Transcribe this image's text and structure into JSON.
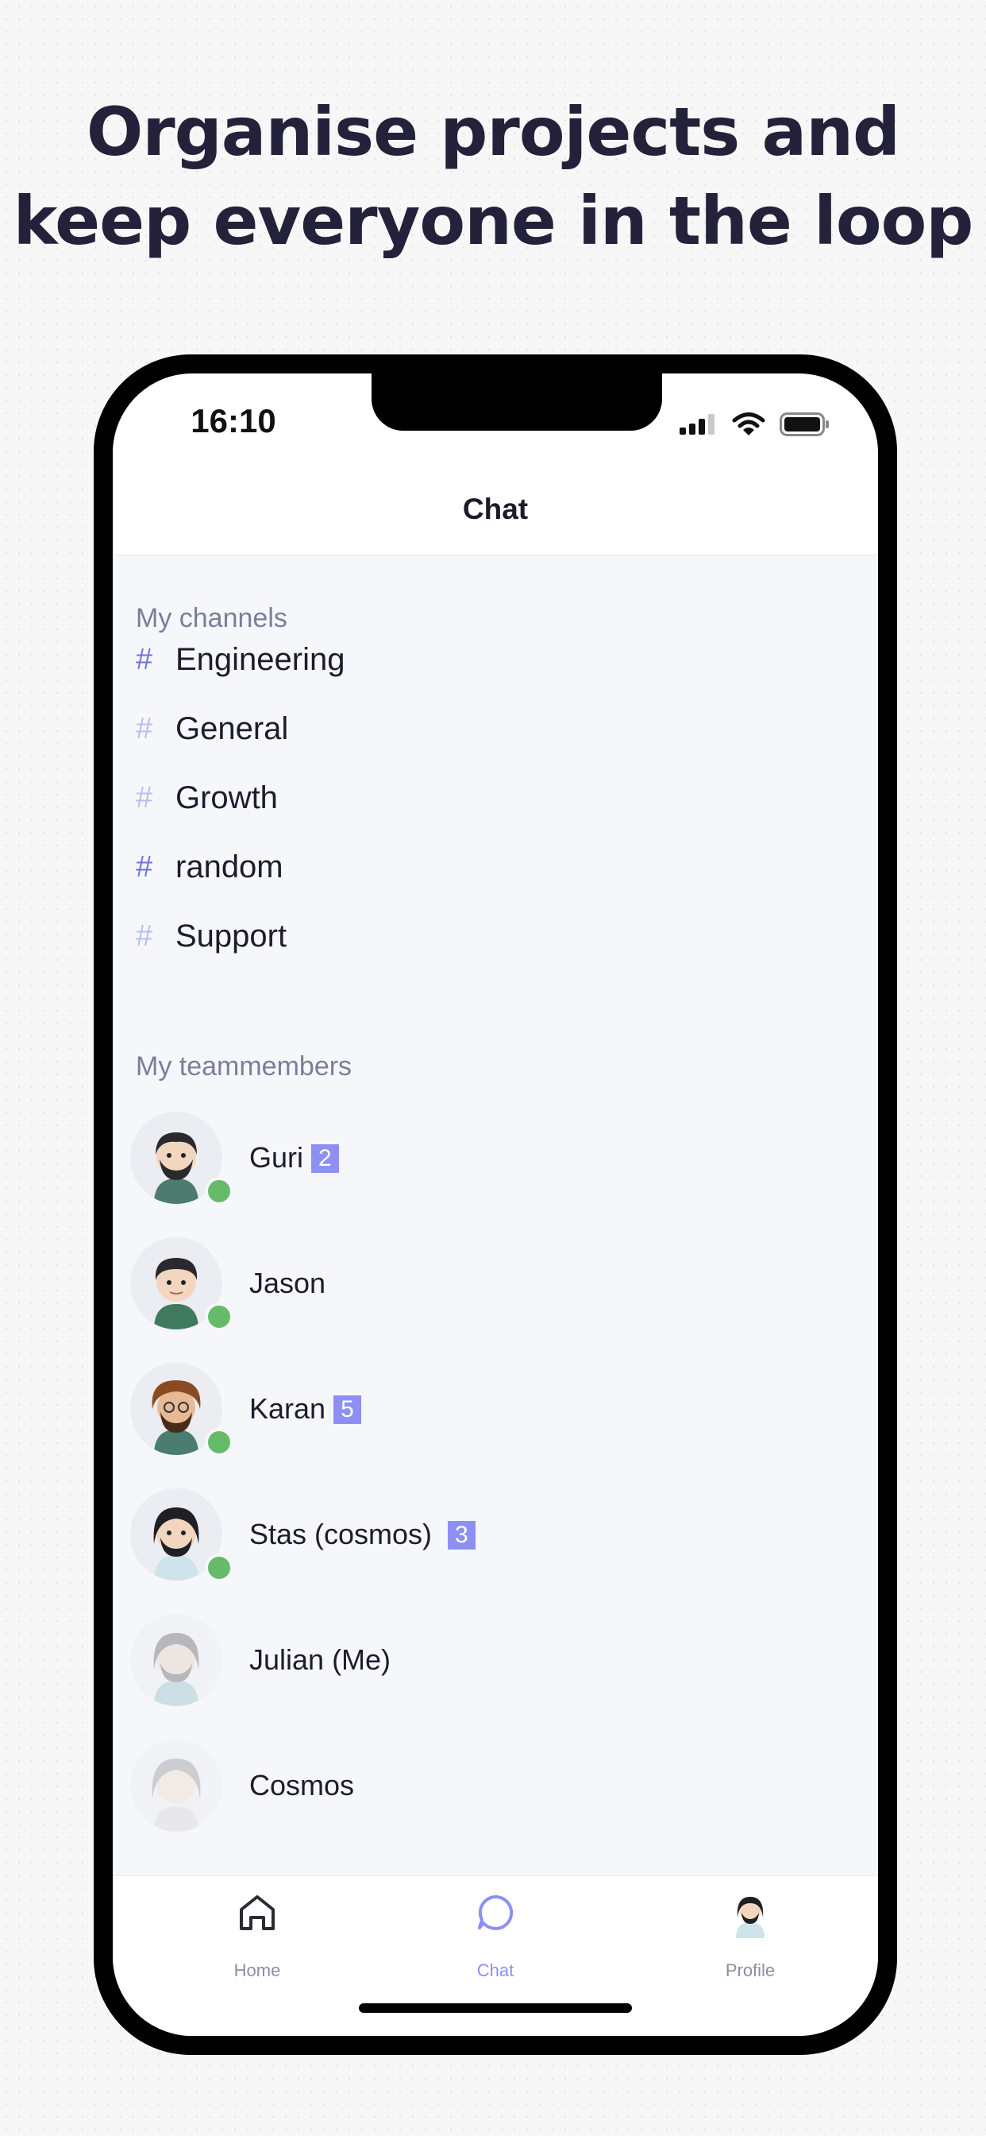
{
  "headline": {
    "line1": "Organise projects and",
    "line2": "keep everyone in the loop"
  },
  "status_bar": {
    "time": "16:10"
  },
  "nav": {
    "title": "Chat"
  },
  "channels": {
    "title": "My channels",
    "items": [
      {
        "hash": "#",
        "label": "Engineering"
      },
      {
        "hash": "#",
        "label": "General"
      },
      {
        "hash": "#",
        "label": "Growth"
      },
      {
        "hash": "#",
        "label": "random"
      },
      {
        "hash": "#",
        "label": "Support"
      }
    ]
  },
  "teammembers": {
    "title": "My teammembers",
    "items": [
      {
        "name": "Guri",
        "badge": "2",
        "online": true
      },
      {
        "name": "Jason",
        "badge": "",
        "online": true
      },
      {
        "name": "Karan",
        "badge": "5",
        "online": true
      },
      {
        "name": "Stas (cosmos)",
        "badge": "3",
        "online": true
      },
      {
        "name": "Julian (Me)",
        "badge": "",
        "online": false
      },
      {
        "name": "Cosmos",
        "badge": "",
        "online": false
      }
    ]
  },
  "tabbar": {
    "home": "Home",
    "chat": "Chat",
    "profile": "Profile"
  },
  "colors": {
    "accent": "#8d90f2",
    "online": "#66bb6a",
    "headline": "#24223a"
  }
}
